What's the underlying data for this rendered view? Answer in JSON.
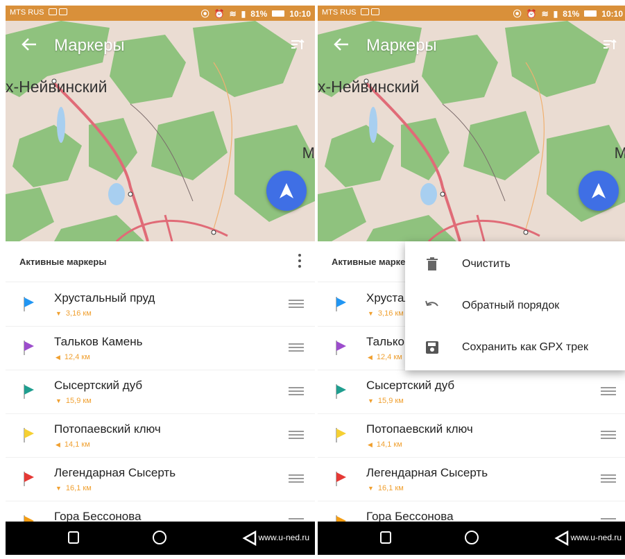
{
  "status_bar": {
    "carrier": "MTS RUS",
    "battery": "81%",
    "time": "10:10"
  },
  "toolbar": {
    "title": "Маркеры"
  },
  "map": {
    "city_label": "х-Нейвинский",
    "edge_label": "М"
  },
  "list": {
    "header": "Активные маркеры",
    "items": [
      {
        "name": "Хрустальный пруд",
        "distance": "3,16 км",
        "color": "#2196f3",
        "arrow": "▼"
      },
      {
        "name": "Тальков Камень",
        "distance": "12,4 км",
        "color": "#9c4dcc",
        "arrow": "◀"
      },
      {
        "name": "Сысертский дуб",
        "distance": "15,9 км",
        "color": "#1f9e8f",
        "arrow": "▼"
      },
      {
        "name": "Потопаевский ключ",
        "distance": "14,1 км",
        "color": "#f5d033",
        "arrow": "◀"
      },
      {
        "name": "Легендарная Сысерть",
        "distance": "16,1 км",
        "color": "#e53935",
        "arrow": "▼"
      },
      {
        "name": "Гора Бессонова",
        "distance": "",
        "color": "#f39c12",
        "arrow": ""
      }
    ]
  },
  "menu": {
    "items": [
      {
        "label": "Очистить",
        "icon": "trash-icon"
      },
      {
        "label": "Обратный порядок",
        "icon": "undo-icon"
      },
      {
        "label": "Сохранить как GPX трек",
        "icon": "save-icon"
      }
    ]
  },
  "watermark": "www.u-ned.ru",
  "colors": {
    "status_bar": "#d9903a",
    "fab": "#3f6fe5",
    "distance": "#f0a030",
    "map_green": "#8fc27e",
    "road": "#e06b77"
  }
}
